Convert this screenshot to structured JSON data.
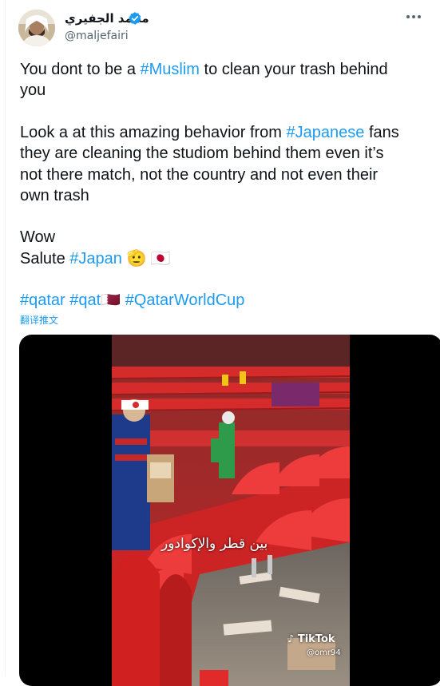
{
  "author": {
    "name": "محمد الجفيري",
    "handle": "@maljefairi",
    "verified_color": "#1d9bf0"
  },
  "tweet": {
    "lines": [
      [
        {
          "t": "You dont to be a ",
          "tag": false
        },
        {
          "t": "#Muslim",
          "tag": true
        },
        {
          "t": " to clean your trash behind",
          "tag": false
        }
      ],
      [
        {
          "t": "you",
          "tag": false
        }
      ],
      [
        {
          "t": "",
          "tag": false
        }
      ],
      [
        {
          "t": "Look a at this amazing behavior from ",
          "tag": false
        },
        {
          "t": "#Japanese",
          "tag": true
        },
        {
          "t": " fans",
          "tag": false
        }
      ],
      [
        {
          "t": "they are cleaning the studiom behind them even it’s",
          "tag": false
        }
      ],
      [
        {
          "t": "not there match, not the country and not even their",
          "tag": false
        }
      ],
      [
        {
          "t": "own trash",
          "tag": false
        }
      ],
      [
        {
          "t": "",
          "tag": false
        }
      ],
      [
        {
          "t": "Wow",
          "tag": false
        }
      ],
      [
        {
          "t": "Salute ",
          "tag": false
        },
        {
          "t": "#Japan",
          "tag": true
        },
        {
          "t": " 🫡 🇯🇵",
          "tag": false
        }
      ],
      [
        {
          "t": "",
          "tag": false
        }
      ],
      [
        {
          "t": "#qatar",
          "tag": true
        },
        {
          "t": " ",
          "tag": false
        },
        {
          "t": "#qat",
          "tag": true
        },
        {
          "t": "🇶🇦",
          "tag": false
        },
        {
          "t": " ",
          "tag": false
        },
        {
          "t": "#QatarWorldCup",
          "tag": true
        }
      ]
    ],
    "translate_label": "翻译推文",
    "link_color": "#1d9bf0"
  },
  "media": {
    "caption": "بين قطر والإكوادور",
    "watermark": "TikTok",
    "watermark_user": "@omr94"
  }
}
